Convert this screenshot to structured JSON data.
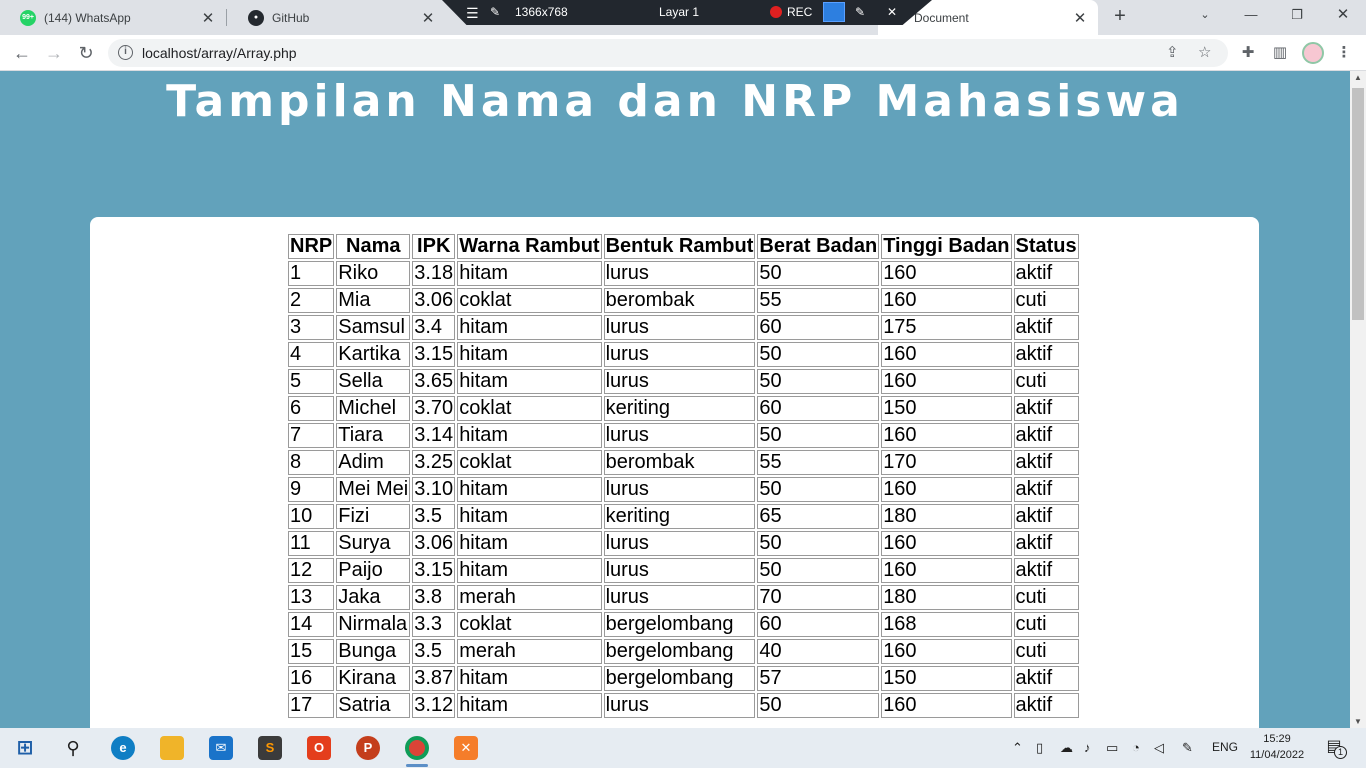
{
  "browser": {
    "tabs": [
      {
        "title": "(144) WhatsApp",
        "badge": "99+"
      },
      {
        "title": "GitHub"
      },
      {
        "title": "Document"
      }
    ],
    "recorder": {
      "resolution": "1366x768",
      "layer": "Layar 1",
      "rec_label": "REC"
    },
    "url": "localhost/array/Array.php"
  },
  "page": {
    "title": "Tampilan Nama dan NRP Mahasiswa",
    "headers": [
      "NRP",
      "Nama",
      "IPK",
      "Warna Rambut",
      "Bentuk Rambut",
      "Berat Badan",
      "Tinggi Badan",
      "Status"
    ],
    "rows": [
      [
        "1",
        "Riko",
        "3.18",
        "hitam",
        "lurus",
        "50",
        "160",
        "aktif"
      ],
      [
        "2",
        "Mia",
        "3.06",
        "coklat",
        "berombak",
        "55",
        "160",
        "cuti"
      ],
      [
        "3",
        "Samsul",
        "3.4",
        "hitam",
        "lurus",
        "60",
        "175",
        "aktif"
      ],
      [
        "4",
        "Kartika",
        "3.15",
        "hitam",
        "lurus",
        "50",
        "160",
        "aktif"
      ],
      [
        "5",
        "Sella",
        "3.65",
        "hitam",
        "lurus",
        "50",
        "160",
        "cuti"
      ],
      [
        "6",
        "Michel",
        "3.70",
        "coklat",
        "keriting",
        "60",
        "150",
        "aktif"
      ],
      [
        "7",
        "Tiara",
        "3.14",
        "hitam",
        "lurus",
        "50",
        "160",
        "aktif"
      ],
      [
        "8",
        "Adim",
        "3.25",
        "coklat",
        "berombak",
        "55",
        "170",
        "aktif"
      ],
      [
        "9",
        "Mei Mei",
        "3.10",
        "hitam",
        "lurus",
        "50",
        "160",
        "aktif"
      ],
      [
        "10",
        "Fizi",
        "3.5",
        "hitam",
        "keriting",
        "65",
        "180",
        "aktif"
      ],
      [
        "11",
        "Surya",
        "3.06",
        "hitam",
        "lurus",
        "50",
        "160",
        "aktif"
      ],
      [
        "12",
        "Paijo",
        "3.15",
        "hitam",
        "lurus",
        "50",
        "160",
        "aktif"
      ],
      [
        "13",
        "Jaka",
        "3.8",
        "merah",
        "lurus",
        "70",
        "180",
        "cuti"
      ],
      [
        "14",
        "Nirmala",
        "3.3",
        "coklat",
        "bergelombang",
        "60",
        "168",
        "cuti"
      ],
      [
        "15",
        "Bunga",
        "3.5",
        "merah",
        "bergelombang",
        "40",
        "160",
        "cuti"
      ],
      [
        "16",
        "Kirana",
        "3.87",
        "hitam",
        "bergelombang",
        "57",
        "150",
        "aktif"
      ],
      [
        "17",
        "Satria",
        "3.12",
        "hitam",
        "lurus",
        "50",
        "160",
        "aktif"
      ]
    ]
  },
  "taskbar": {
    "lang": "ENG",
    "time": "15:29",
    "date": "11/04/2022",
    "notifications": "1"
  },
  "colors": {
    "page_background": "#62a2bb",
    "card_background": "#ffffff",
    "tab_strip": "#dee1e6"
  }
}
